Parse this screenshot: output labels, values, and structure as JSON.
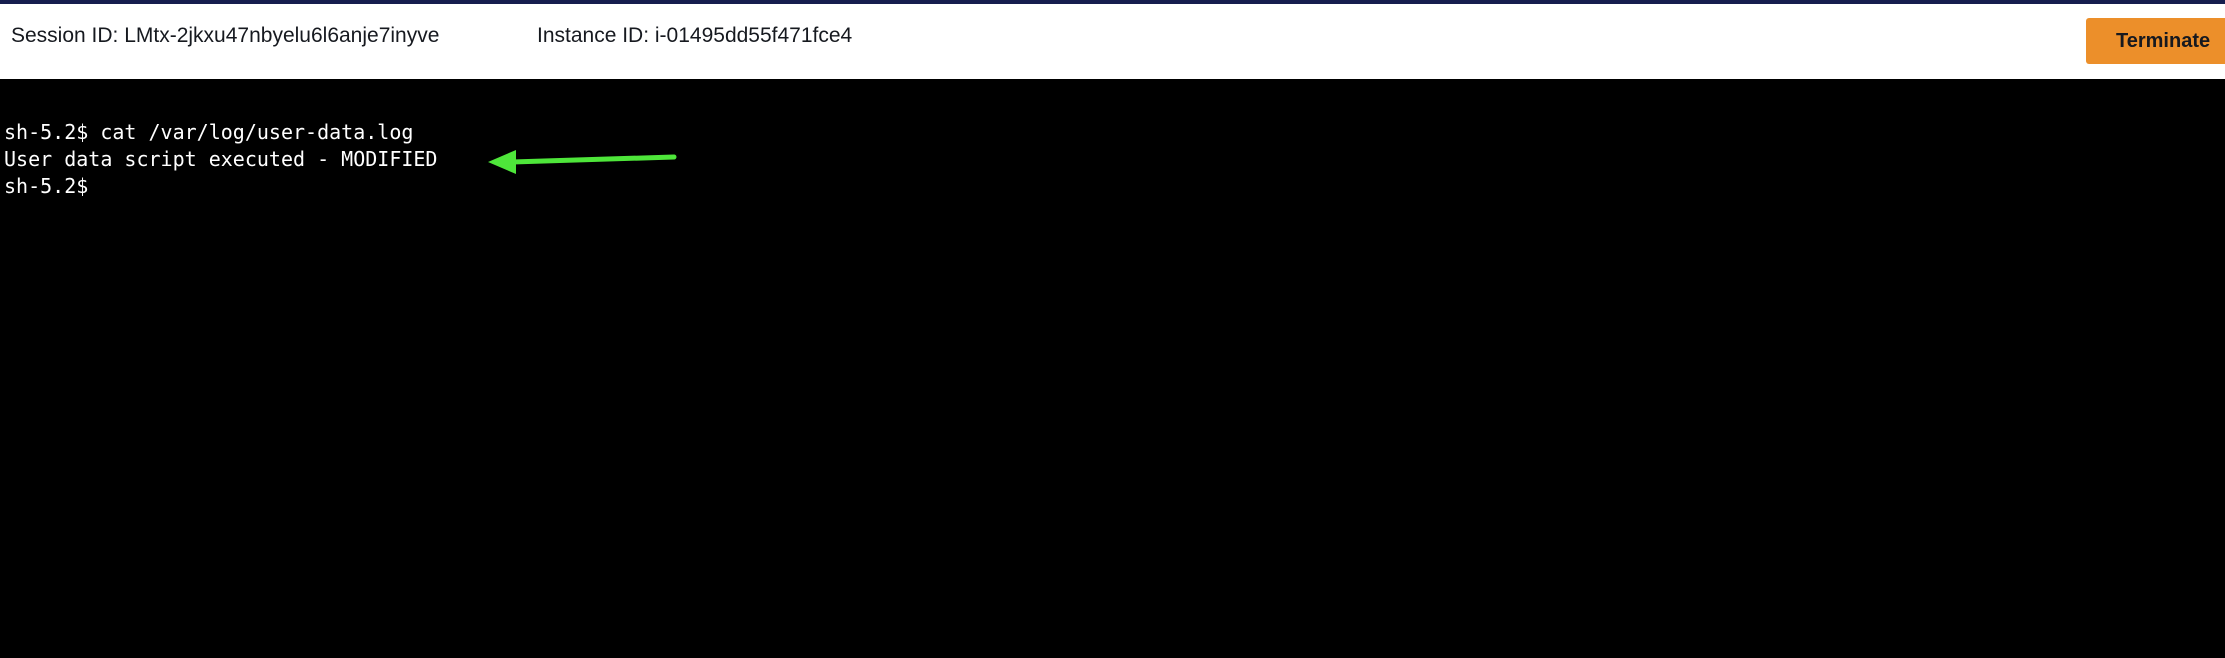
{
  "header": {
    "session_id": "Session ID: LMtx-2jkxu47nbyelu6l6anje7inyve",
    "instance_id": "Instance ID: i-01495dd55f471fce4",
    "terminate_label": "Terminate"
  },
  "terminal": {
    "lines": [
      "sh-5.2$ cat /var/log/user-data.log",
      "User data script executed - MODIFIED",
      "sh-5.2$"
    ]
  },
  "colors": {
    "top_border": "#161d4e",
    "header_bg": "#ffffff",
    "terminate_button": "#ec8f2a",
    "terminal_bg": "#000000",
    "terminal_text": "#ffffff",
    "annotation_arrow": "#4ee63a"
  },
  "icons": {
    "annotation": "arrow-left-icon"
  }
}
